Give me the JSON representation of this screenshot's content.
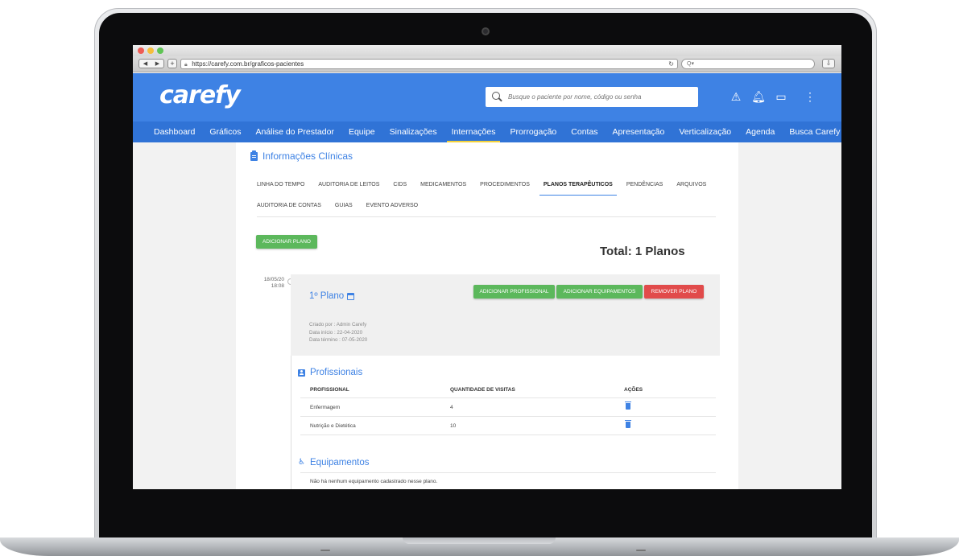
{
  "browser": {
    "url": "https://carefy.com.br/graficos-pacientes",
    "search_placeholder": "Q▾"
  },
  "header": {
    "logo": "carefy",
    "search_placeholder": "Busque o paciente por nome, código ou senha"
  },
  "nav": {
    "items": [
      "Dashboard",
      "Gráficos",
      "Análise do Prestador",
      "Equipe",
      "Sinalizações",
      "Internações",
      "Prorrogação",
      "Contas",
      "Apresentação",
      "Verticalização",
      "Agenda",
      "Busca Carefy"
    ],
    "active": "Internações"
  },
  "section": {
    "title": "Informações Clínicas"
  },
  "tabs": {
    "row1": [
      "LINHA DO TEMPO",
      "AUDITORIA DE LEITOS",
      "CIDS",
      "MEDICAMENTOS",
      "PROCEDIMENTOS",
      "PLANOS TERAPÊUTICOS",
      "PENDÊNCIAS",
      "ARQUIVOS"
    ],
    "row2": [
      "AUDITORIA DE CONTAS",
      "GUIAS",
      "EVENTO ADVERSO"
    ],
    "active": "PLANOS TERAPÊUTICOS"
  },
  "actions": {
    "add_plan": "ADICIONAR PLANO",
    "total": "Total: 1 Planos"
  },
  "plan": {
    "date": "18/05/20",
    "time": "18:08",
    "title": "1º Plano",
    "add_professional": "ADICIONAR PROFISSIONAL",
    "add_equipment": "ADICIONAR EQUIPAMENTOS",
    "remove_plan": "REMOVER PLANO",
    "created_by": "Criado por : Admin Carefy",
    "start_date": "Data início : 22-04-2020",
    "end_date": "Data término : 07-05-2020"
  },
  "professionals": {
    "title": "Profissionais",
    "columns": [
      "PROFISSIONAL",
      "QUANTIDADE DE VISITAS",
      "AÇÕES"
    ],
    "rows": [
      {
        "name": "Enfermagem",
        "visits": "4"
      },
      {
        "name": "Nutrição e Dietética",
        "visits": "10"
      }
    ]
  },
  "equipment": {
    "title": "Equipamentos",
    "empty": "Não há nenhum equipamento cadastrado nesse plano."
  },
  "colors": {
    "brand_blue": "#3e82e4",
    "nav_blue": "#3073d6",
    "active_underline": "#f5d23a",
    "green": "#5cb85c",
    "red": "#e14b4b"
  }
}
